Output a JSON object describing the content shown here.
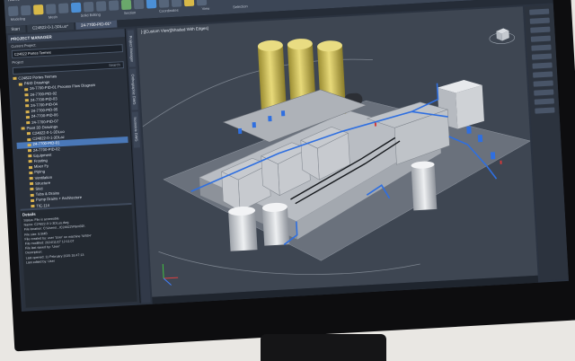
{
  "app": {
    "menu_tabs": [
      "Home",
      "Solids",
      "Structure",
      "Modeling",
      "Visualize",
      "Annotate",
      "Manage",
      "Output",
      "Add-ins",
      "Collaborate",
      "Help",
      "Express Tools",
      "Featured Apps"
    ],
    "active_tab": "Modeling",
    "ribbon_groups": [
      "Modeling",
      "Mesh",
      "Solid Editing",
      "Section",
      "Coordinates",
      "View",
      "Selection"
    ],
    "ribbon_tools": {
      "box": "Box",
      "extrude": "Extrude",
      "polysolid": "Polysolid",
      "presspull": "Presspull",
      "smooth": "Smooth Object",
      "union": "Union",
      "extract_edges": "Extract Edges",
      "extrude_faces": "Extrude Faces",
      "separate": "Separate",
      "unsaved_view": "Unsaved View",
      "no_filter": "No Filter",
      "single_viewport": "Single viewport"
    }
  },
  "doc_tabs": [
    "Start",
    "C24822-0-1-3DLuo*",
    "24-7700-PID-01*"
  ],
  "active_doc": "24-7700-PID-01*",
  "viewport_label": "[-][Custom View][Shaded With Edges]",
  "project_manager": {
    "title": "PROJECT MANAGER",
    "current_project_label": "Current Project:",
    "current_project": "C24822 Portes Termes",
    "project_label": "Project",
    "search_placeholder": "Search",
    "tree": [
      {
        "label": "C24822 Portes Termes",
        "level": 0
      },
      {
        "label": "P&ID Drawings",
        "level": 1
      },
      {
        "label": "24-7700-PID-01 Process Flow Diagram",
        "level": 2
      },
      {
        "label": "24-7700-PID-02",
        "level": 2
      },
      {
        "label": "24-7700-PID-03",
        "level": 2
      },
      {
        "label": "24-7700-PID-04",
        "level": 2
      },
      {
        "label": "24-7700-PID-05",
        "level": 2
      },
      {
        "label": "24-7700-PID-06",
        "level": 2
      },
      {
        "label": "24-7700-PID-07",
        "level": 2
      },
      {
        "label": "Plant 3D Drawings",
        "level": 1
      },
      {
        "label": "C24822-0-1-3DLuo",
        "level": 2
      },
      {
        "label": "C24822-0-1-3DLaz",
        "level": 2
      },
      {
        "label": "24-7700-PID-01",
        "level": 2,
        "selected": true
      },
      {
        "label": "24-7700-PID-02",
        "level": 2
      },
      {
        "label": "Equipment",
        "level": 2
      },
      {
        "label": "Frosting",
        "level": 2
      },
      {
        "label": "Mixer Fy",
        "level": 2
      },
      {
        "label": "Piping",
        "level": 2
      },
      {
        "label": "Ventilation",
        "level": 2
      },
      {
        "label": "Structure",
        "level": 2
      },
      {
        "label": "Skid",
        "level": 2
      },
      {
        "label": "Tubs & Drains",
        "level": 2
      },
      {
        "label": "Pump Drains + Architecture",
        "level": 2
      },
      {
        "label": "TIE-114",
        "level": 2
      },
      {
        "label": "Orthos Spaces",
        "level": 1
      },
      {
        "label": "Related Files",
        "level": 1
      }
    ],
    "details_title": "Details",
    "details": [
      "Status: File is accessible",
      "Name: C24822-0-1-3DLuo.dwg",
      "File location: C:\\Users\\...\\C24822\\Plant3D\\",
      "File size: 8.5MB",
      "File created by: user 'User' on machine 'WS04'",
      "File modified: 2024/11/27 12:11:07",
      "File last saved by: 'User'",
      "Description:",
      "Last opened: 11 February 2025 18:47:13",
      "Last edited by: User"
    ]
  },
  "side_tabs": [
    "Project Manager",
    "Orthographic DWG",
    "Isometric DWG"
  ],
  "colors": {
    "ribbon": "#3c4656",
    "panel": "#2a313c",
    "viewport": "#3e4652",
    "tank": "#d6c45e",
    "pipe_blue": "#2f6fe0",
    "equipment": "#c9ccd1"
  }
}
